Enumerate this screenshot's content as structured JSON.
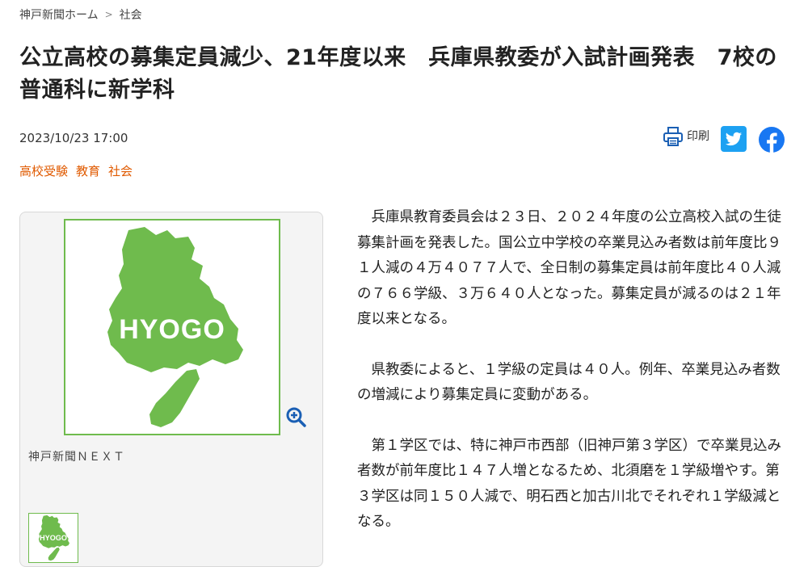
{
  "breadcrumb": {
    "home": "神戸新聞ホーム",
    "separator": ">",
    "section": "社会"
  },
  "article": {
    "title": "公立高校の募集定員減少、21年度以来　兵庫県教委が入試計画発表　7校の普通科に新学科",
    "datetime": "2023/10/23 17:00",
    "tags": [
      "高校受験",
      "教育",
      "社会"
    ],
    "paragraphs": [
      "兵庫県教育委員会は２３日、２０２４年度の公立高校入試の生徒募集計画を発表した。国公立中学校の卒業見込み者数は前年度比９１人減の４万４０７７人で、全日制の募集定員は前年度比４０人減の７６６学級、３万６４０人となった。募集定員が減るのは２１年度以来となる。",
      "県教委によると、１学級の定員は４０人。例年、卒業見込み者数の増減により募集定員に変動がある。",
      "第１学区では、特に神戸市西部（旧神戸第３学区）で卒業見込み者数が前年度比１４７人増となるため、北須磨を１学級増やす。第３学区は同１５０人減で、明石西と加古川北でそれぞれ１学級減となる。"
    ]
  },
  "tools": {
    "print_label": "印刷",
    "print_icon": "printer-icon",
    "twitter_icon": "twitter-icon",
    "facebook_icon": "facebook-icon"
  },
  "figure": {
    "image_text": "HYOGO",
    "thumb_text": "HYOGO",
    "caption": "神戸新聞ＮＥＸＴ",
    "zoom_icon": "zoom-in-icon"
  },
  "colors": {
    "accent": "#e05a00",
    "map_green": "#6fbb4d",
    "twitter": "#1da1f2",
    "facebook": "#1877f2",
    "zoom": "#1a5fb4"
  }
}
